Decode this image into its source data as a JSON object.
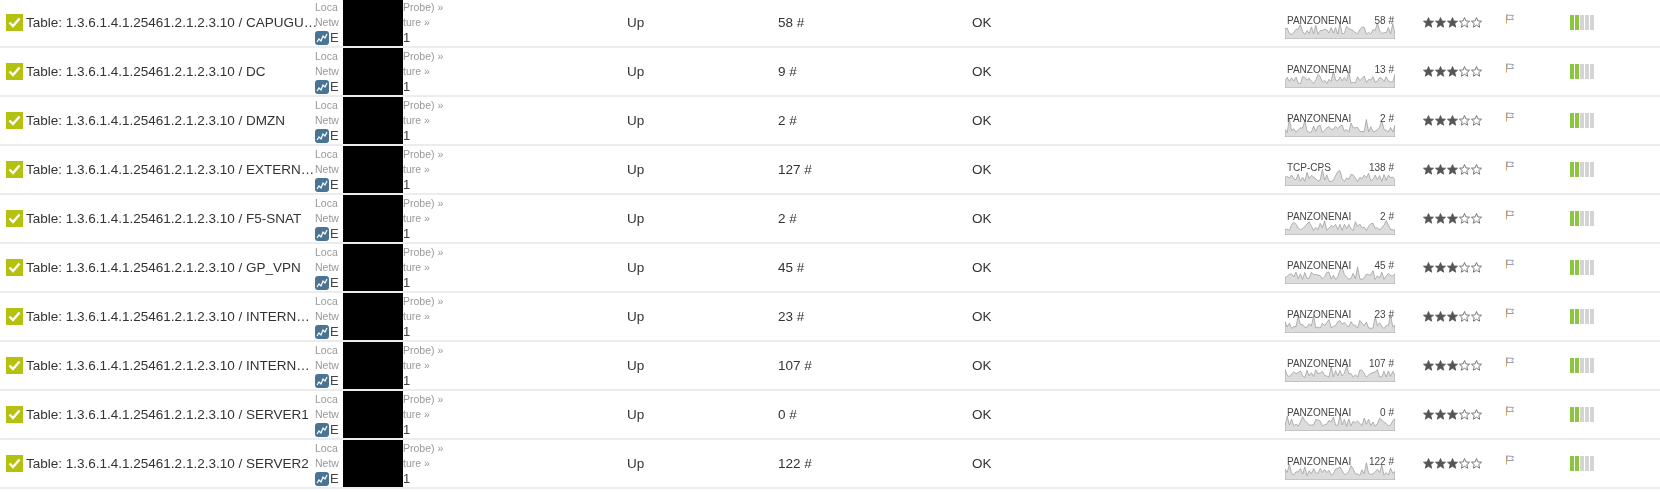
{
  "rows": [
    {
      "name": "Table: 1.3.6.1.4.1.25461.2.1.2.3.10 / CAPUGU…",
      "device": {
        "line1_start": "Loca",
        "line1_end": "Probe) »",
        "line2_start": "Netw",
        "line2_end": "ture »",
        "line3_start": "E",
        "line3_end": "1"
      },
      "status": "Up",
      "value": "58 #",
      "message": "OK",
      "sparkline": {
        "channel": "PANZONENAI",
        "value": "58 #"
      },
      "stars": 3,
      "level": 0.4
    },
    {
      "name": "Table: 1.3.6.1.4.1.25461.2.1.2.3.10 / DC",
      "device": {
        "line1_start": "Loca",
        "line1_end": "Probe) »",
        "line2_start": "Netw",
        "line2_end": "ture »",
        "line3_start": "E",
        "line3_end": "1"
      },
      "status": "Up",
      "value": "9 #",
      "message": "OK",
      "sparkline": {
        "channel": "PANZONENAI",
        "value": "13 #"
      },
      "stars": 3,
      "level": 0.4
    },
    {
      "name": "Table: 1.3.6.1.4.1.25461.2.1.2.3.10 / DMZN",
      "device": {
        "line1_start": "Loca",
        "line1_end": "Probe) »",
        "line2_start": "Netw",
        "line2_end": "ture »",
        "line3_start": "E",
        "line3_end": "1"
      },
      "status": "Up",
      "value": "2 #",
      "message": "OK",
      "sparkline": {
        "channel": "PANZONENAI",
        "value": "2 #"
      },
      "stars": 3,
      "level": 0.4
    },
    {
      "name": "Table: 1.3.6.1.4.1.25461.2.1.2.3.10 / EXTERN…",
      "device": {
        "line1_start": "Loca",
        "line1_end": "Probe) »",
        "line2_start": "Netw",
        "line2_end": "ture »",
        "line3_start": "E",
        "line3_end": "1"
      },
      "status": "Up",
      "value": "127 #",
      "message": "OK",
      "sparkline": {
        "channel": "TCP-CPS",
        "value": "138 #"
      },
      "stars": 3,
      "level": 0.4
    },
    {
      "name": "Table: 1.3.6.1.4.1.25461.2.1.2.3.10 / F5-SNAT",
      "device": {
        "line1_start": "Loca",
        "line1_end": "Probe) »",
        "line2_start": "Netw",
        "line2_end": "ture »",
        "line3_start": "E",
        "line3_end": "1"
      },
      "status": "Up",
      "value": "2 #",
      "message": "OK",
      "sparkline": {
        "channel": "PANZONENAI",
        "value": "2 #"
      },
      "stars": 3,
      "level": 0.4
    },
    {
      "name": "Table: 1.3.6.1.4.1.25461.2.1.2.3.10 / GP_VPN",
      "device": {
        "line1_start": "Loca",
        "line1_end": "Probe) »",
        "line2_start": "Netw",
        "line2_end": "ture »",
        "line3_start": "E",
        "line3_end": "1"
      },
      "status": "Up",
      "value": "45 #",
      "message": "OK",
      "sparkline": {
        "channel": "PANZONENAI",
        "value": "45 #"
      },
      "stars": 3,
      "level": 0.4
    },
    {
      "name": "Table: 1.3.6.1.4.1.25461.2.1.2.3.10 / INTERN…",
      "device": {
        "line1_start": "Loca",
        "line1_end": "Probe) »",
        "line2_start": "Netw",
        "line2_end": "ture »",
        "line3_start": "E",
        "line3_end": "1"
      },
      "status": "Up",
      "value": "23 #",
      "message": "OK",
      "sparkline": {
        "channel": "PANZONENAI",
        "value": "23 #"
      },
      "stars": 3,
      "level": 0.4
    },
    {
      "name": "Table: 1.3.6.1.4.1.25461.2.1.2.3.10 / INTERN…",
      "device": {
        "line1_start": "Loca",
        "line1_end": "Probe) »",
        "line2_start": "Netw",
        "line2_end": "ture »",
        "line3_start": "E",
        "line3_end": "1"
      },
      "status": "Up",
      "value": "107 #",
      "message": "OK",
      "sparkline": {
        "channel": "PANZONENAI",
        "value": "107 #"
      },
      "stars": 3,
      "level": 0.4
    },
    {
      "name": "Table: 1.3.6.1.4.1.25461.2.1.2.3.10 / SERVER1",
      "device": {
        "line1_start": "Loca",
        "line1_end": "Probe) »",
        "line2_start": "Netw",
        "line2_end": "ture »",
        "line3_start": "E",
        "line3_end": "1"
      },
      "status": "Up",
      "value": "0 #",
      "message": "OK",
      "sparkline": {
        "channel": "PANZONENAI",
        "value": "0 #"
      },
      "stars": 3,
      "level": 0.4
    },
    {
      "name": "Table: 1.3.6.1.4.1.25461.2.1.2.3.10 / SERVER2",
      "device": {
        "line1_start": "Loca",
        "line1_end": "Probe) »",
        "line2_start": "Netw",
        "line2_end": "ture »",
        "line3_start": "E",
        "line3_end": "1"
      },
      "status": "Up",
      "value": "122 #",
      "message": "OK",
      "sparkline": {
        "channel": "PANZONENAI",
        "value": "122 #"
      },
      "stars": 3,
      "level": 0.4
    }
  ]
}
